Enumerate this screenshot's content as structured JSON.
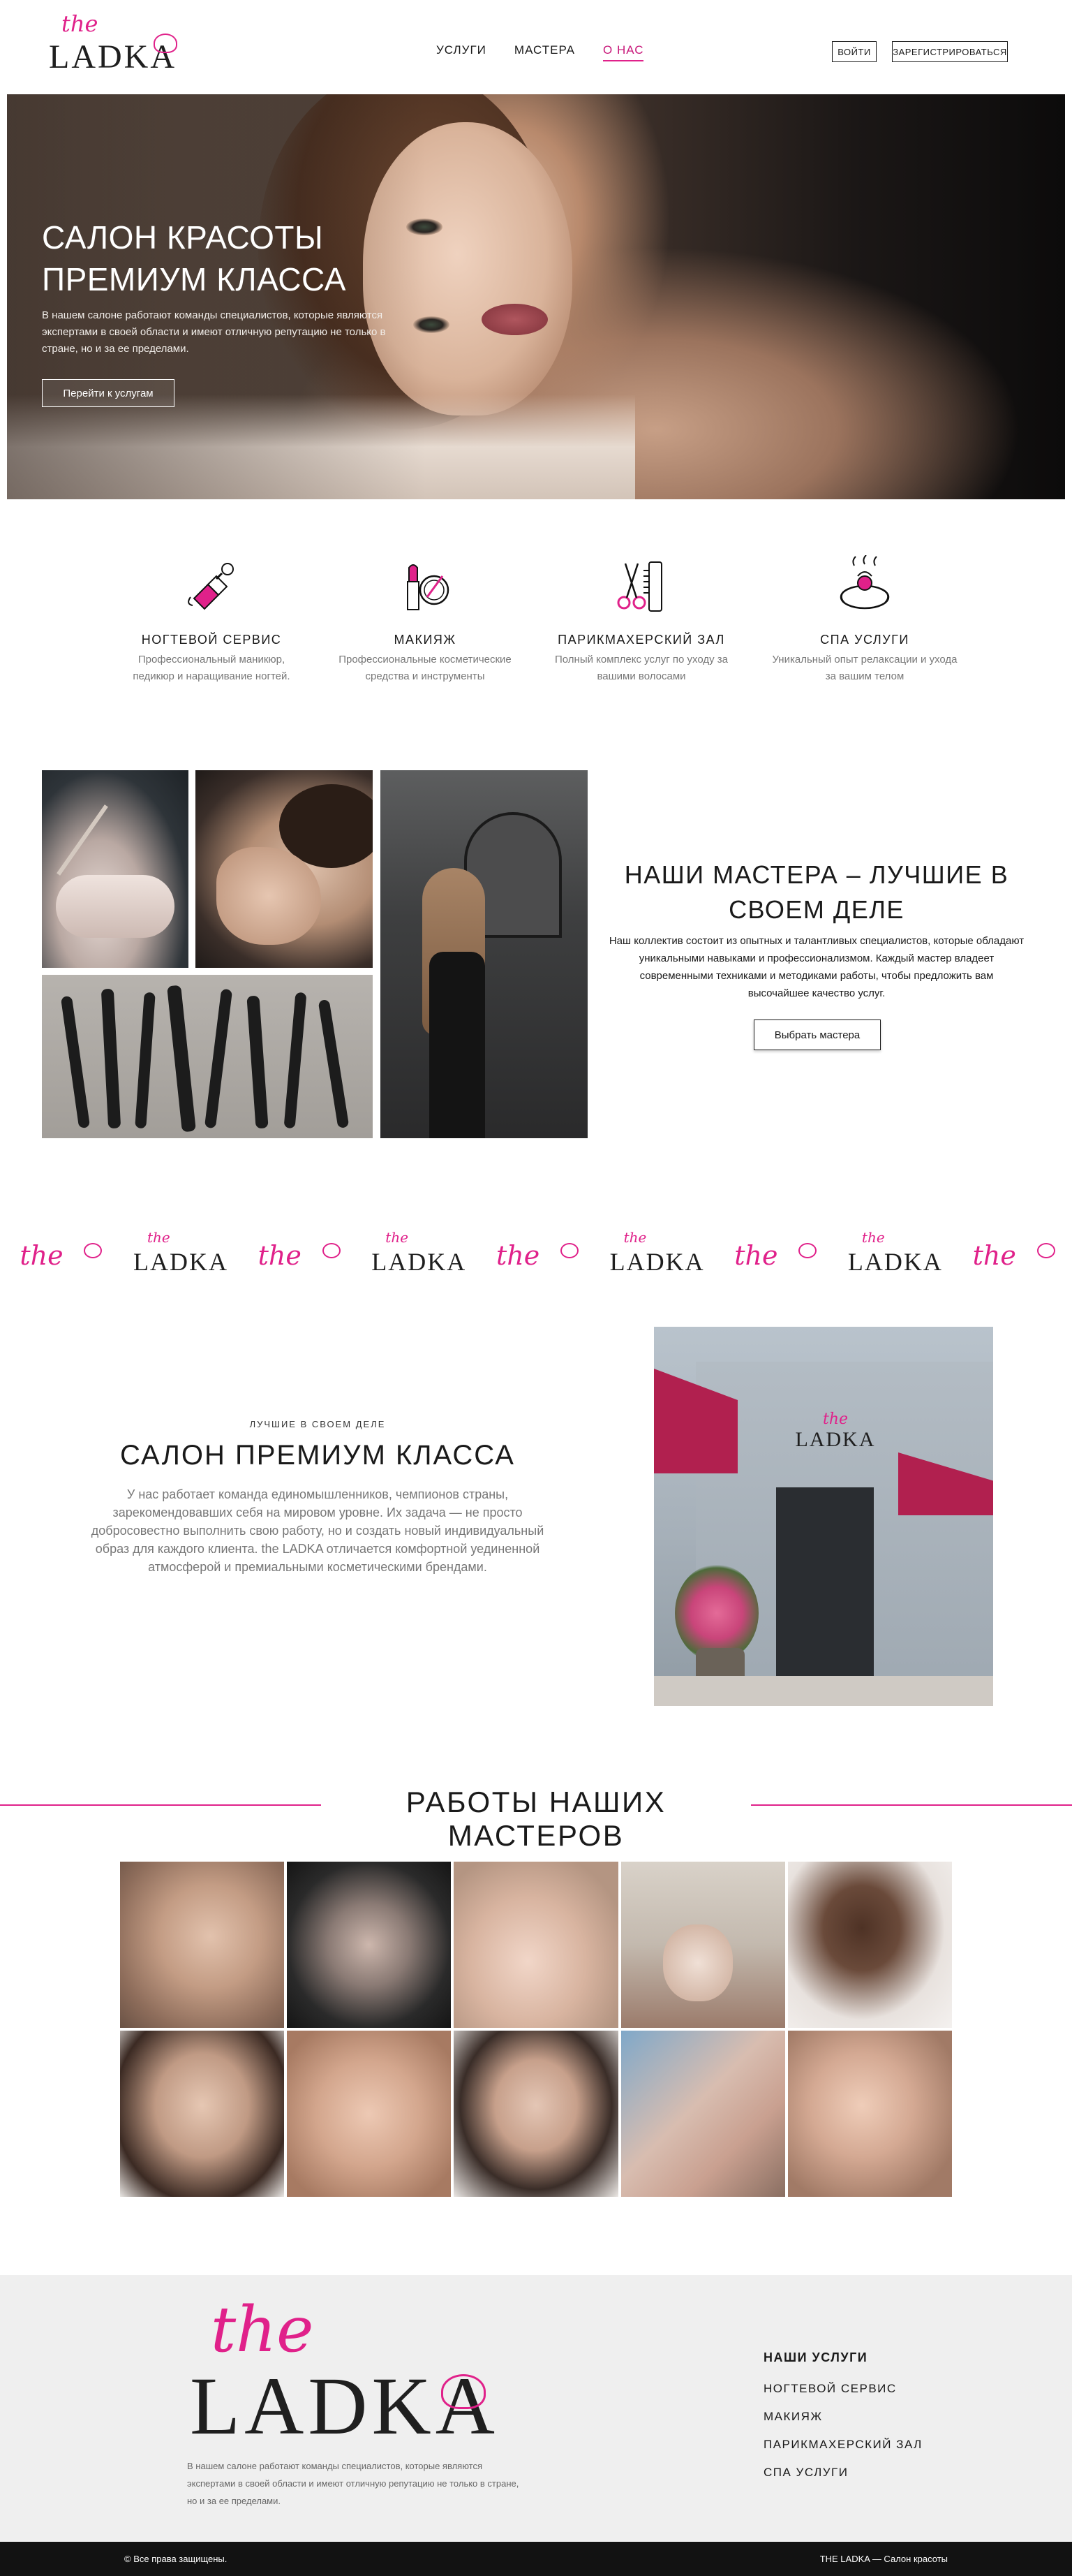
{
  "brand": {
    "script": "the",
    "name": "LADKA",
    "accent": "#e0218a"
  },
  "nav": {
    "services": "УСЛУГИ",
    "masters": "МАСТЕРА",
    "about": "О НАС"
  },
  "auth": {
    "login": "ВОЙТИ",
    "register": "ЗАРЕГИСТРИРОВАТЬСЯ"
  },
  "hero": {
    "title": "САЛОН КРАСОТЫ ПРЕМИУМ КЛАССА",
    "text": "В нашем салоне работают команды специалистов, которые являются экспертами в своей области и имеют отличную репутацию не только в стране, но и за ее пределами.",
    "button": "Перейти к услугам"
  },
  "services": [
    {
      "title": "НОГТЕВОЙ СЕРВИС",
      "desc": "Профессиональный маникюр, педикюр и наращивание ногтей.",
      "icon": "nail-polish-icon"
    },
    {
      "title": "МАКИЯЖ",
      "desc": "Профессиональные косметические средства и инструменты",
      "icon": "makeup-icon"
    },
    {
      "title": "ПАРИКМАХЕРСКИЙ ЗАЛ",
      "desc": "Полный комплекс услуг по уходу за вашими волосами",
      "icon": "scissors-comb-icon"
    },
    {
      "title": "СПА УСЛУГИ",
      "desc": "Уникальный опыт релаксации и ухода за вашим телом",
      "icon": "spa-icon"
    }
  ],
  "masters": {
    "title": "НАШИ МАСТЕРА – ЛУЧШИЕ В СВОЕМ ДЕЛЕ",
    "text": "Наш коллектив состоит из опытных и талантливых специалистов, которые обладают уникальными навыками и профессионализмом. Каждый мастер владеет современными техниками и методиками работы, чтобы предложить вам высочайшее качество услуг.",
    "button": "Выбрать мастера"
  },
  "premium": {
    "kicker": "ЛУЧШИЕ В СВОЕМ ДЕЛЕ",
    "title": "САЛОН ПРЕМИУМ КЛАССА",
    "text": "У нас работает команда единомышленников, чемпионов страны, зарекомендовавших себя на мировом уровне. Их задача — не просто добросовестно выполнить свою работу, но и создать новый индивидуальный образ для каждого клиента. the LADKA отличается комфортной уединенной атмосферой и премиальными косметическими брендами."
  },
  "works": {
    "title": "РАБОТЫ НАШИХ МАСТЕРОВ"
  },
  "footer": {
    "text": "В нашем салоне работают команды специалистов, которые являются экспертами в своей области и имеют отличную репутацию не только в стране, но и за ее пределами.",
    "nav_title": "НАШИ УСЛУГИ",
    "links": [
      "НОГТЕВОЙ СЕРВИС",
      "МАКИЯЖ",
      "ПАРИКМАХЕРСКИЙ ЗАЛ",
      "СПА УСЛУГИ"
    ],
    "copyright": "© Все права защищены.",
    "tagline": "THE LADKA — Салон красоты"
  }
}
